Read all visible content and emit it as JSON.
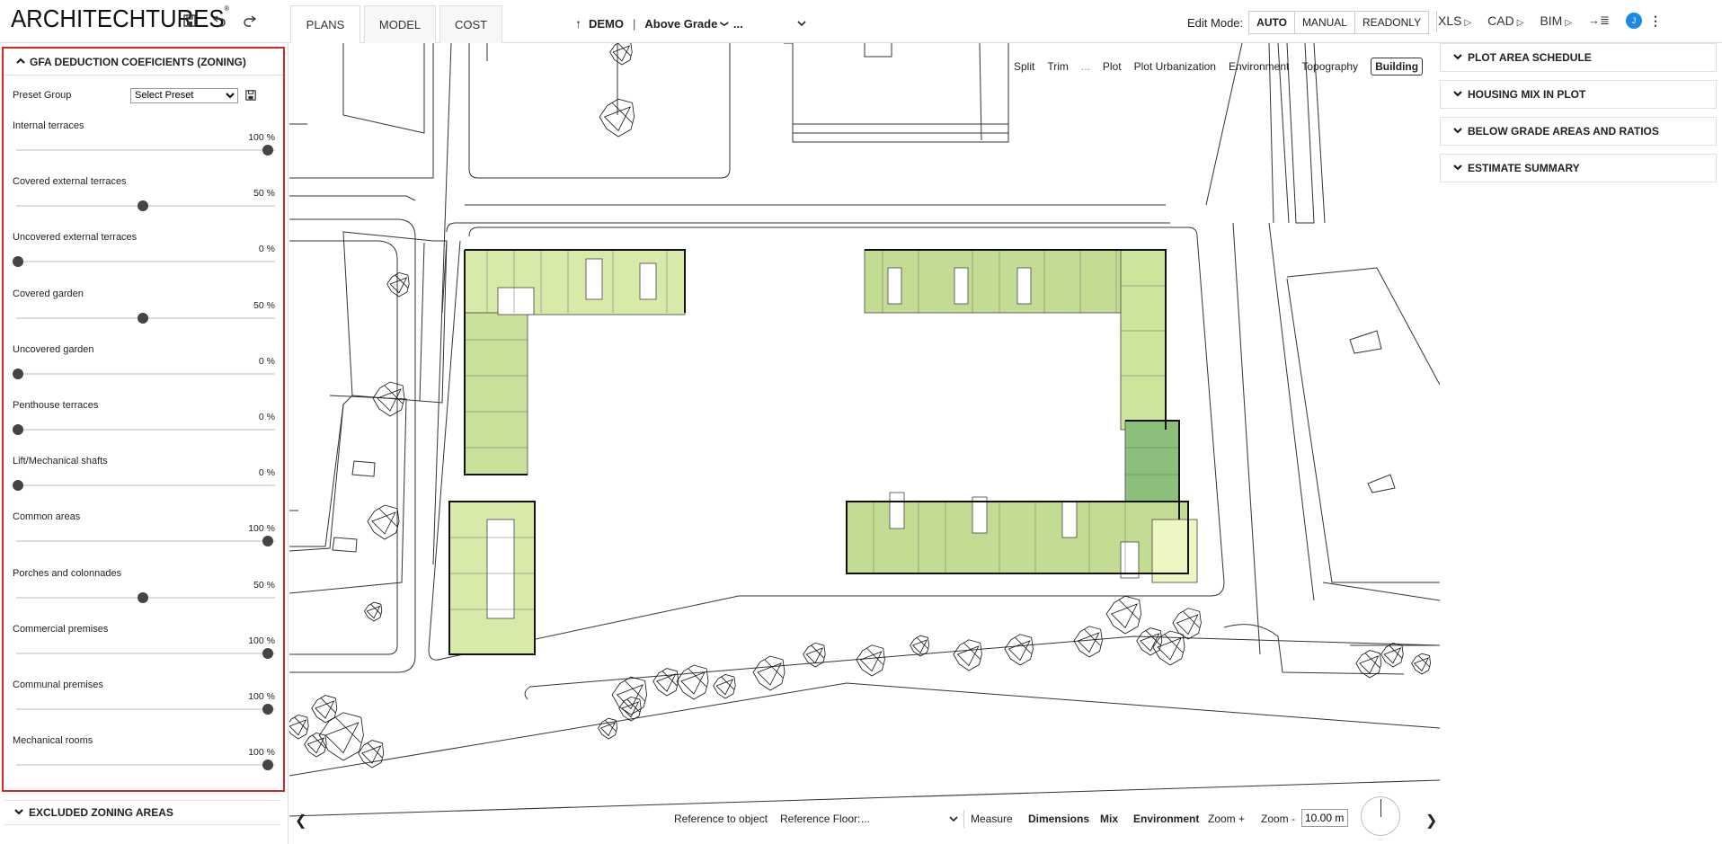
{
  "app": {
    "logo": "ARCHITECHTURES",
    "logo_mark": "®"
  },
  "tabs": [
    {
      "label": "PLANS"
    },
    {
      "label": "MODEL"
    },
    {
      "label": "COST"
    }
  ],
  "crumb": {
    "project": "DEMO",
    "separator": "|",
    "level": "Above Grade",
    "level_chevron": "❯",
    "ellipsis": "..."
  },
  "edit_mode": {
    "label": "Edit Mode:",
    "options": [
      "AUTO",
      "MANUAL",
      "READONLY"
    ],
    "selected": "AUTO"
  },
  "exports": {
    "xls": "XLS",
    "cad": "CAD",
    "bim": "BIM",
    "avatar": "J"
  },
  "left_panel": {
    "title": "GFA DEDUCTION COEFICIENTS (ZONING)",
    "preset_label": "Preset Group",
    "preset_value": "Select Preset",
    "sliders": [
      {
        "name": "Internal terraces",
        "value": 100,
        "pct": "100 %"
      },
      {
        "name": "Covered external terraces",
        "value": 50,
        "pct": "50 %"
      },
      {
        "name": "Uncovered external terraces",
        "value": 0,
        "pct": "0 %"
      },
      {
        "name": "Covered garden",
        "value": 50,
        "pct": "50 %"
      },
      {
        "name": "Uncovered garden",
        "value": 0,
        "pct": "0 %"
      },
      {
        "name": "Penthouse terraces",
        "value": 0,
        "pct": "0 %"
      },
      {
        "name": "Lift/Mechanical shafts",
        "value": 0,
        "pct": "0 %"
      },
      {
        "name": "Common areas",
        "value": 100,
        "pct": "100 %"
      },
      {
        "name": "Porches and colonnades",
        "value": 50,
        "pct": "50 %"
      },
      {
        "name": "Commercial premises",
        "value": 100,
        "pct": "100 %"
      },
      {
        "name": "Communal premises",
        "value": 100,
        "pct": "100 %"
      },
      {
        "name": "Mechanical rooms",
        "value": 100,
        "pct": "100 %"
      }
    ],
    "collapsed_section": "EXCLUDED ZONING AREAS"
  },
  "view_tabs": {
    "items": [
      "Split",
      "Trim",
      "...",
      "Plot",
      "Plot Urbanization",
      "Environment",
      "Topography",
      "Building"
    ],
    "active": "Building"
  },
  "bottom_bar": {
    "reference_object": "Reference to object",
    "reference_floor": "Reference Floor:",
    "reference_floor_value": "...",
    "measure": "Measure",
    "dimensions": "Dimensions",
    "mix": "Mix",
    "environment": "Environment",
    "zoom_in": "Zoom +",
    "zoom_out": "Zoom -",
    "zoom_value": "10.00 m"
  },
  "right_panel": {
    "sections": [
      "PLOT AREA SCHEDULE",
      "HOUSING MIX IN PLOT",
      "BELOW GRADE AREAS AND RATIOS",
      "ESTIMATE SUMMARY"
    ]
  },
  "colors": {
    "highlight": "#d62828",
    "unit_light": "#d7eaa9",
    "unit_mid": "#c2dd93",
    "unit_dark": "#8cbf7c",
    "unit_pale": "#eef6c4",
    "avatar": "#1e88e5"
  }
}
